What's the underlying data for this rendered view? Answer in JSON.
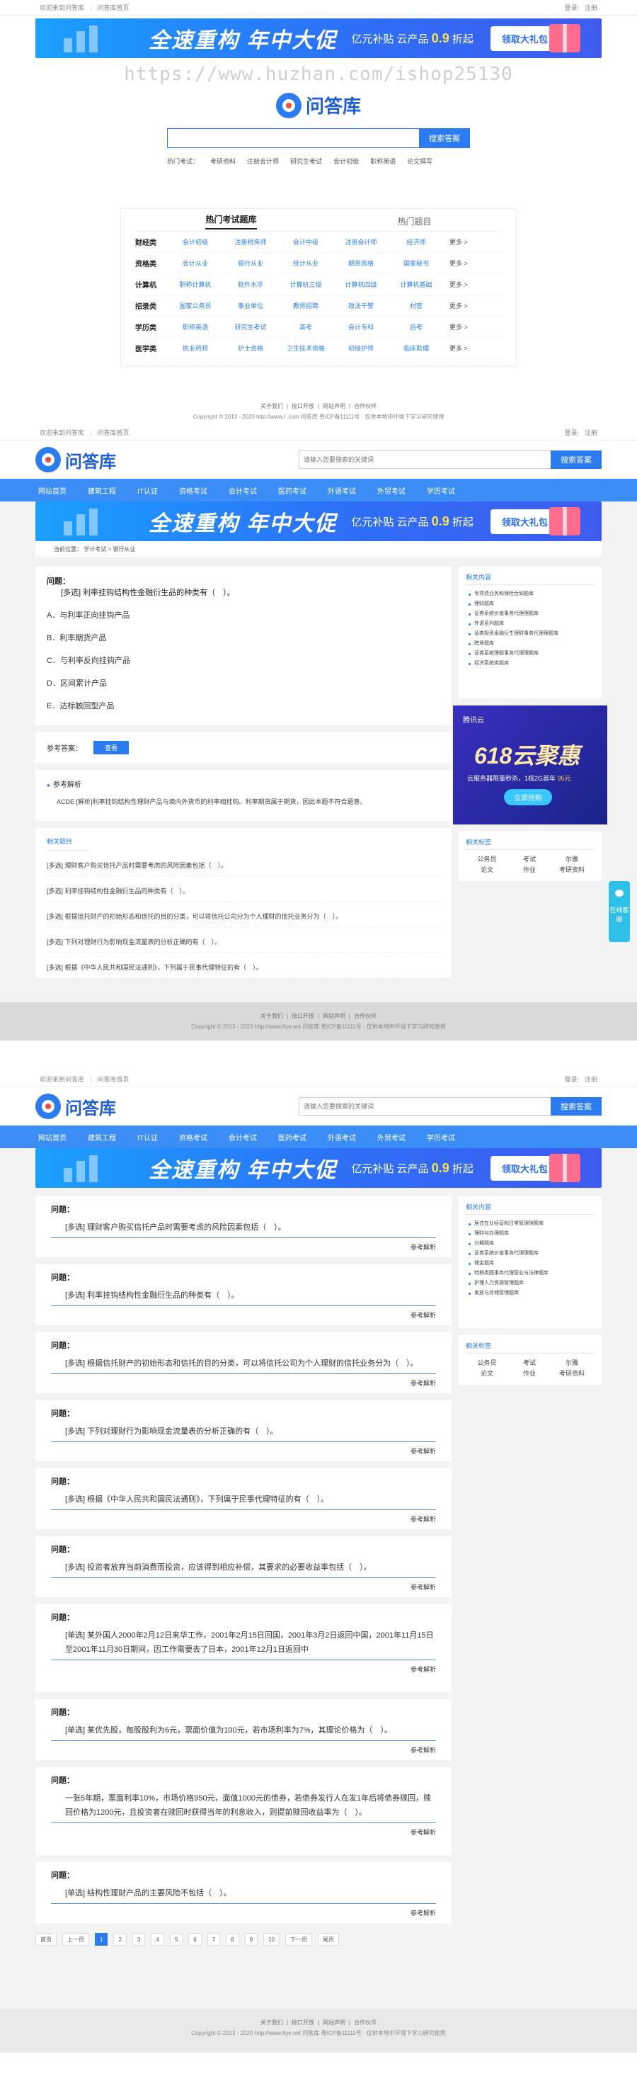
{
  "topbar": {
    "welcome": "欢迎来到问答库",
    "home": "问答库首页",
    "login": "登录",
    "register": "注册"
  },
  "banner": {
    "title": "全速重构 年中大促",
    "sub_prefix": "亿元补贴 云产品",
    "sub_highlight": "0.9",
    "sub_suffix": "折起",
    "button": "领取大礼包"
  },
  "watermark": "https://www.huzhan.com/ishop25130",
  "logo": {
    "text": "问答库"
  },
  "search": {
    "button": "搜索答案",
    "placeholder": "请输入您要搜索的关键词"
  },
  "hot_search": {
    "label": "热门考试：",
    "items": [
      "考研资料",
      "注册会计师",
      "研究生考试",
      "会计初级",
      "职称英语",
      "论文撰写"
    ]
  },
  "hot_box": {
    "tabs": [
      "热门考试题库",
      "热门题目"
    ],
    "rows": [
      {
        "name": "财经类",
        "items": [
          "会计初级",
          "注册税务师",
          "会计中级",
          "注册会计师",
          "经济师"
        ]
      },
      {
        "name": "资格类",
        "items": [
          "会计从业",
          "银行从业",
          "统计从业",
          "期货资格",
          "国家秘书"
        ]
      },
      {
        "name": "计算机",
        "items": [
          "职称计算机",
          "软件水平",
          "计算机三级",
          "计算机四级",
          "计算机基础"
        ]
      },
      {
        "name": "招录类",
        "items": [
          "国家公务员",
          "事业单位",
          "教师招聘",
          "政法干警",
          "村官"
        ]
      },
      {
        "name": "学历类",
        "items": [
          "职称英语",
          "研究生考试",
          "高考",
          "会计专科",
          "自考"
        ]
      },
      {
        "name": "医学类",
        "items": [
          "执业药师",
          "护士资格",
          "卫生技术资格",
          "初级护师",
          "临床助理"
        ]
      }
    ],
    "more": "更多 >"
  },
  "footer": {
    "links": [
      "关于我们",
      "接口开放",
      "网站声明",
      "合作伙伴"
    ],
    "copyright1": "Copyright © 2013 - 2020 http://www.l         .com  问答库   粤ICP备11111号 · 仅供本地中环境下学习研究使用",
    "copyright2": "Copyright © 2013 - 2020 http://www.8ye.net  问答库   粤ICP备11111号 · 仅供本地中环境下学习研究使用"
  },
  "nav": [
    "网站首页",
    "建筑工程",
    "IT认证",
    "资格考试",
    "会计考试",
    "医药考试",
    "外语考试",
    "外贸考试",
    "学历考试"
  ],
  "crumb": "当前位置： 学计考试 > 银行从业",
  "detail": {
    "question": "[多选] 利率挂钩结构性金融衍生品的种类有（　）。",
    "options": [
      "A．与利率正向挂钩产品",
      "B．利率期货产品",
      "C．与利率反向挂钩产品",
      "D．区间累计产品",
      "E．达标触回型产品"
    ],
    "answer_label": "参考答案：",
    "view_button": "查看",
    "analysis_title": "参考解析",
    "analysis_text": "ACDE [解析]利率挂钩结构性理财产品与境内外货币的利率相挂钩。利率期货属于期货，因此本题不符合题意。",
    "related_title": "相关题目",
    "related": [
      "[多选] 理财客户购买信托产品时需要考虑的风险因素包括（　）。",
      "[多选] 利率挂钩结构性金融衍生品的种类有（　）。",
      "[多选] 根据信托财产的初始形态和信托的目的分类，可以将信托公司分为个人理财的信托业务分为（　）。",
      "[多选] 下列对理财行为影响现金流量表的分析正确的有（　）。",
      "[多选] 根据《中华人民共和国民法通则》，下列属于民事代理特征的有（　）。"
    ]
  },
  "sidebar": {
    "hot_title": "相关内容",
    "hot_items": [
      "专项债业务和保险合同题库",
      "理财题库",
      "证券系统价值事务代理理题库",
      "外语系列题库",
      "证券投资金融衍生理财事务代理理题库",
      "跨境题库",
      "证券系统理题事务代理理题库",
      "经济系统类题库"
    ],
    "hot_items2": [
      "居住在业经营和日常管理理题库",
      "理财与办理题库",
      "分期题库",
      "证券系统价值事务代理理题库",
      "储金题库",
      "特种类图事务代理营业与法律题库",
      "护理人力资源管理题库",
      "发放与存储管理题库"
    ],
    "tag_title": "相关标签",
    "tags": [
      "公务员",
      "考试",
      "尔雅",
      "论文",
      "作业",
      "考研资料"
    ]
  },
  "ad": {
    "brand": "腾讯云",
    "big": "618云聚惠",
    "sub_prefix": "云服务器限量秒杀，1核2G首年",
    "sub_highlight": "95元",
    "button": "立即抢购"
  },
  "float": {
    "label": "在线客服"
  },
  "qa": {
    "header": "问题：",
    "more": "参考解析",
    "items": [
      "[多选] 理财客户购买信托产品时需要考虑的风险因素包括（　）。",
      "[多选] 利率挂钩结构性金融衍生品的种类有（　）。",
      "[多选] 根据信托财产的初始形态和信托的目的分类，可以将信托公司为个人理财的信托业务分为（　）。",
      "[多选] 下列对理财行为影响现金流量表的分析正确的有（　）。",
      "[多选] 根据《中华人民共和国民法通则》，下列属于民事代理特征的有（　）。",
      "[多选] 投资者放弃当前消费而投资，应该得到相应补偿，其要求的必要收益率包括（　）。",
      "[单选] 某外国人2000年2月12日来华工作，2001年2月15日回国，2001年3月2日返回中国，2001年11月15日至2001年11月30日期间，因工作需要去了日本，2001年12月1日返回中",
      "[单选] 某优先股，每股股利为6元，票面价值为100元，若市场利率为7%，其理论价格为（　）。",
      "一张5年期，票面利率10%，市场价格950元，面值1000元的债券，若债券发行人在发1年后将债券赎回，赎回价格为1200元，且投资者在赎回时获得当年的利息收入，则提前赎回收益率为（　）。",
      "[单选] 结构性理财产品的主要风险不包括（　）。"
    ]
  },
  "pager": [
    "首页",
    "上一页",
    "1",
    "2",
    "3",
    "4",
    "5",
    "6",
    "7",
    "8",
    "9",
    "10",
    "下一页",
    "尾页"
  ]
}
